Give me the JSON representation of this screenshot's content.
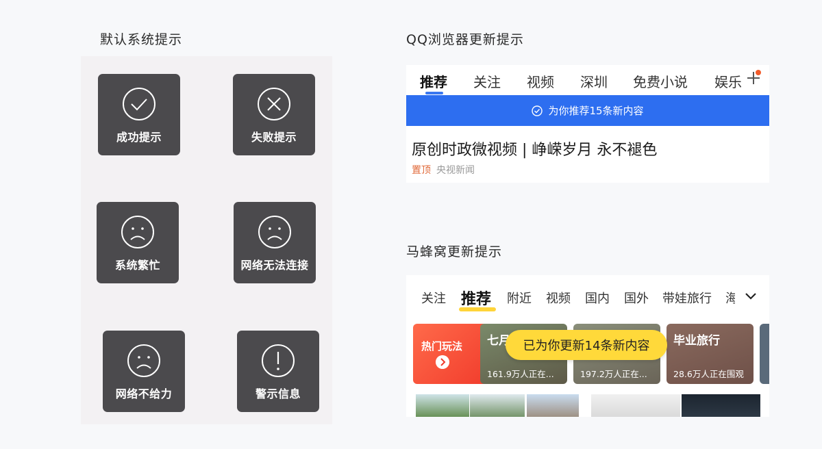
{
  "sections": {
    "default": "默认系统提示",
    "qq": "QQ浏览器更新提示",
    "mfw": "马蜂窝更新提示"
  },
  "toasts": [
    {
      "icon": "check-circle-icon",
      "label": "成功提示"
    },
    {
      "icon": "x-circle-icon",
      "label": "失败提示"
    },
    {
      "icon": "sad-face-icon",
      "label": "系统繁忙"
    },
    {
      "icon": "sad-face-icon",
      "label": "网络无法连接"
    },
    {
      "icon": "sad-face-icon",
      "label": "网络不给力"
    },
    {
      "icon": "exclamation-circle-icon",
      "label": "警示信息"
    }
  ],
  "qq": {
    "tabs": [
      "推荐",
      "关注",
      "视频",
      "深圳",
      "免费小说",
      "娱乐"
    ],
    "active_tab": "推荐",
    "banner": "为你推荐15条新内容",
    "headline": "原创时政微视频 | 峥嵘岁月 永不褪色",
    "pin": "置顶",
    "source": "央视新闻",
    "accent": "#2d6ef0"
  },
  "mfw": {
    "tabs": [
      "关注",
      "推荐",
      "附近",
      "视频",
      "国内",
      "国外",
      "带娃旅行",
      "海"
    ],
    "active_tab": "推荐",
    "toast": "已为你更新14条新内容",
    "cards": [
      {
        "title": "热门玩法",
        "sub": ""
      },
      {
        "title": "七月",
        "sub": "161.9万人正在..."
      },
      {
        "title": "",
        "sub": "197.2万人正在..."
      },
      {
        "title": "毕业旅行",
        "sub": "28.6万人正在围观"
      }
    ],
    "accent": "#ffd43a"
  }
}
